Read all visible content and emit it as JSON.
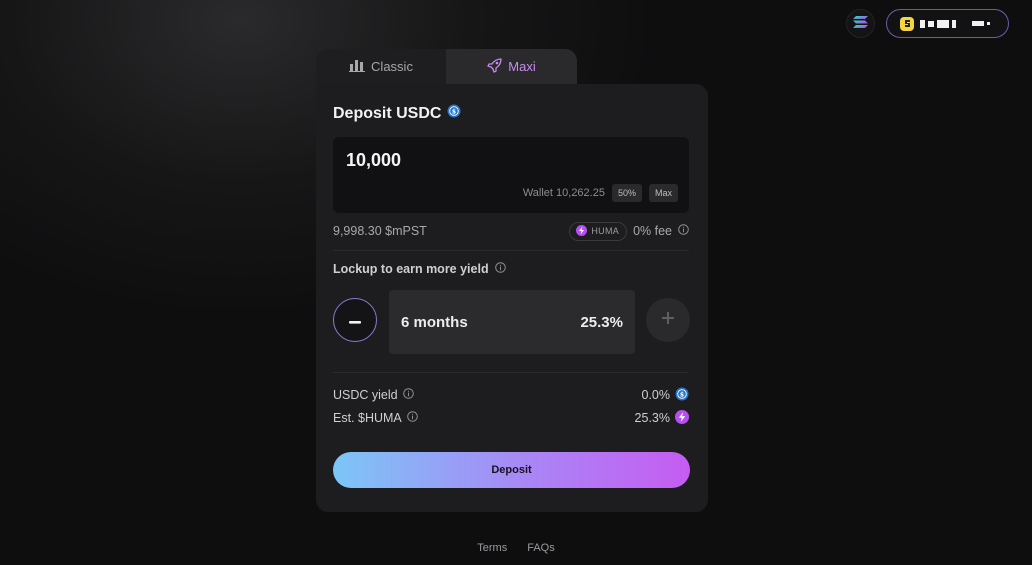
{
  "header": {
    "chain_icon": "solana-icon",
    "wallet_icon": "wallet-coin-icon"
  },
  "tabs": [
    {
      "label": "Classic",
      "icon": "bar-chart-icon"
    },
    {
      "label": "Maxi",
      "icon": "rocket-icon"
    }
  ],
  "deposit": {
    "title": "Deposit USDC",
    "amount": "10,000",
    "wallet_label": "Wallet 10,262.25",
    "half_label": "50%",
    "max_label": "Max"
  },
  "receive": {
    "amount": "9,998.30 $mPST",
    "badge": "HUMA",
    "fee": "0% fee"
  },
  "lockup": {
    "label": "Lockup to earn more yield",
    "period": "6 months",
    "apy": "25.3%"
  },
  "stats": {
    "usdc_yield_label": "USDC yield",
    "usdc_yield_value": "0.0%",
    "huma_label": "Est. $HUMA",
    "huma_value": "25.3%"
  },
  "action": {
    "deposit_label": "Deposit"
  },
  "footer": {
    "terms": "Terms",
    "faqs": "FAQs"
  },
  "colors": {
    "accent_gradient_start": "#7cc6f7",
    "accent_gradient_end": "#c65cf2",
    "maxi_tab_text": "#c98bf0",
    "usdc_blue": "#2775ca",
    "huma_purple": "#b64ff0"
  }
}
